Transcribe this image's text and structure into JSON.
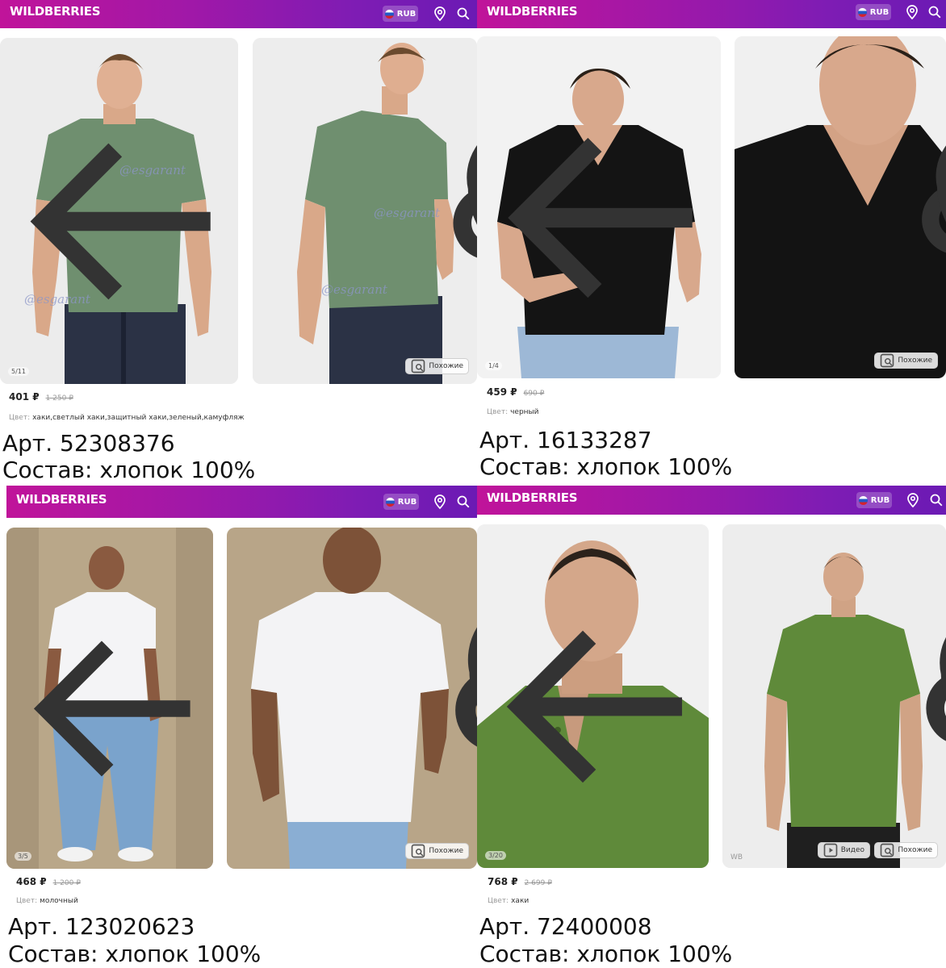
{
  "brand": {
    "logo": "WILDBERRIES",
    "currency": "RUB",
    "colors": {
      "header_start": "#c0149a",
      "header_end": "#6b1ab4"
    }
  },
  "icons": [
    "back-arrow-icon",
    "share-icon",
    "heart-icon",
    "location-pin-icon",
    "search-icon",
    "similar-icon",
    "play-icon"
  ],
  "similar_label": "Похожие",
  "video_label": "Видео",
  "color_label": "Цвет:",
  "products": [
    {
      "counter": "5/11",
      "watermark": "@esgarant",
      "price": "401 ₽",
      "old_price": "1 250 ₽",
      "color": "хаки,светлый хаки,защитный хаки,зеленый,камуфляж",
      "article": "Арт. 52308376",
      "composition": "Состав: хлопок 100%"
    },
    {
      "counter": "1/4",
      "price": "459 ₽",
      "old_price": "690 ₽",
      "color": "черный",
      "article": "Арт. 16133287",
      "composition": "Состав: хлопок 100%"
    },
    {
      "counter": "3/5",
      "price": "468 ₽",
      "old_price": "1 200 ₽",
      "color": "молочный",
      "article": "Арт. 123020623",
      "composition": "Состав: хлопок 100%"
    },
    {
      "counter": "3/20",
      "wb_mark": "WB",
      "price": "768 ₽",
      "old_price": "2 699 ₽",
      "color": "хаки",
      "article": "Арт. 72400008",
      "composition": "Состав: хлопок 100%"
    }
  ]
}
